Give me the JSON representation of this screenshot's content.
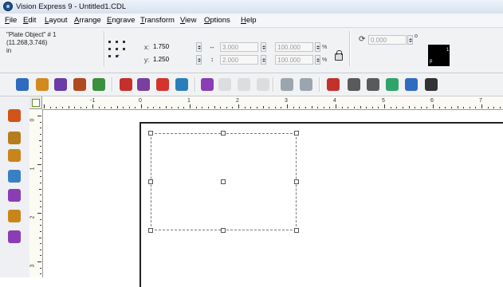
{
  "window": {
    "title": "Vision Express 9 - Untitled1.CDL",
    "app_icon": "vision-express-app-icon"
  },
  "menu": [
    {
      "label": "File",
      "u": "F",
      "rest": "ile"
    },
    {
      "label": "Edit",
      "u": "E",
      "rest": "dit"
    },
    {
      "label": "Layout",
      "u": "L",
      "rest": "ayout"
    },
    {
      "label": "Arrange",
      "u": "A",
      "rest": "rrange"
    },
    {
      "label": "Engrave",
      "u": "E",
      "rest": "ngrave"
    },
    {
      "label": "Transform",
      "u": "T",
      "rest": "ransform"
    },
    {
      "label": "View",
      "u": "V",
      "rest": "iew"
    },
    {
      "label": "Options",
      "u": "O",
      "rest": "ptions"
    },
    {
      "label": "Help",
      "u": "H",
      "rest": "elp"
    }
  ],
  "properties": {
    "object_name": "\"Plate Object\" # 1",
    "object_size": "(11.268,3.746)",
    "units": "in",
    "x_label": "x:",
    "x_value": "1.750",
    "y_label": "y:",
    "y_value": "1.250",
    "width_value": "3.000",
    "height_value": "2.000",
    "width_pct": "100.000",
    "height_pct": "100.000",
    "pct_symbol": "%",
    "rotation_value": "0.000",
    "degree_symbol": "o",
    "swatch_label": "p",
    "swatch_number": "1",
    "swatch_color": "#000000"
  },
  "toolbar_icons": [
    "new-document-icon",
    "open-folder-icon",
    "print-preview-icon",
    "print-icon",
    "engrave-icon",
    "import-icon",
    "image-icon",
    "fill-icon",
    "save-icon",
    "plate-icon",
    "star-icon",
    "star-disabled-icon",
    "arrange-disabled-icon",
    "grid-icon",
    "grid2-icon",
    "star-cross-icon",
    "node-edit-icon",
    "node-add-icon",
    "color-icon",
    "layer-icon",
    "move-icon"
  ],
  "left_tools": [
    "select-arrow-icon",
    "stamp-icon",
    "text-tool-icon",
    "zoom-tool-icon",
    "paint-icon",
    "pencil-icon",
    "pen-icon"
  ],
  "ruler": {
    "h_labels": [
      "-1",
      "0",
      "1",
      "2",
      "3",
      "4",
      "5",
      "6",
      "7"
    ],
    "v_labels": [
      "0",
      "1",
      "2",
      "3"
    ]
  }
}
